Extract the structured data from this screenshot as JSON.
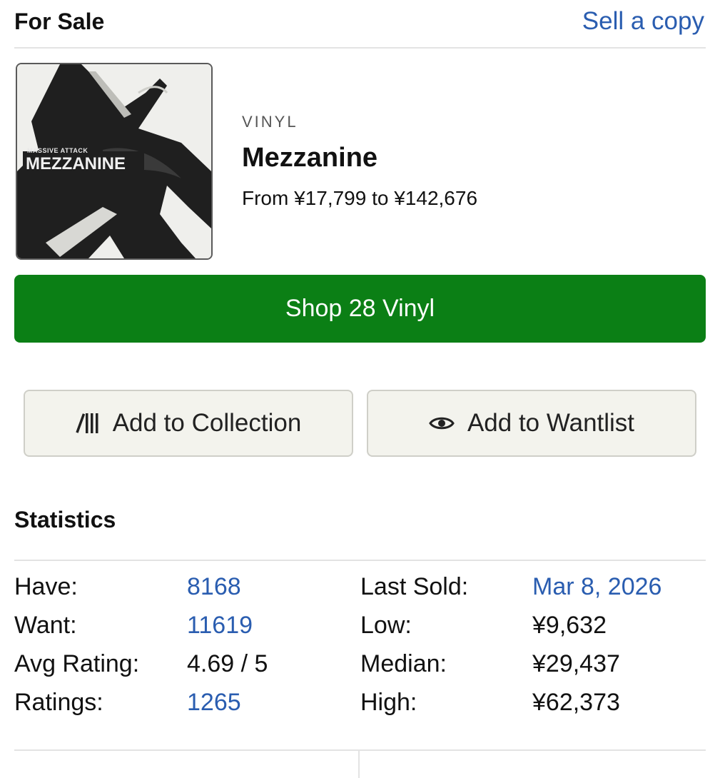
{
  "header": {
    "title": "For Sale",
    "sell_link": "Sell a copy"
  },
  "release": {
    "cover_artist_text": "MASSIVE ATTACK",
    "cover_title_text": "MEZZANINE",
    "format": "VINYL",
    "title": "Mezzanine",
    "price_range": "From ¥17,799 to ¥142,676"
  },
  "shop_button": {
    "label": "Shop 28 Vinyl"
  },
  "actions": {
    "collection_label": "Add to Collection",
    "collection_icon": "vinyl-collection-icon",
    "wantlist_label": "Add to Wantlist",
    "wantlist_icon": "eye-icon"
  },
  "statistics": {
    "title": "Statistics",
    "left": [
      {
        "label": "Have:",
        "value": "8168"
      },
      {
        "label": "Want:",
        "value": "11619"
      },
      {
        "label": "Avg Rating:",
        "value": "4.69 / 5"
      },
      {
        "label": "Ratings:",
        "value": "1265"
      }
    ],
    "right": [
      {
        "label": "Last Sold:",
        "value": "Mar 8, 2026"
      },
      {
        "label": "Low:",
        "value": "¥9,632"
      },
      {
        "label": "Median:",
        "value": "¥29,437"
      },
      {
        "label": "High:",
        "value": "¥62,373"
      }
    ]
  },
  "colors": {
    "link": "#2a5db0",
    "shop_green": "#0b7f15",
    "action_bg": "#f3f3ed"
  }
}
